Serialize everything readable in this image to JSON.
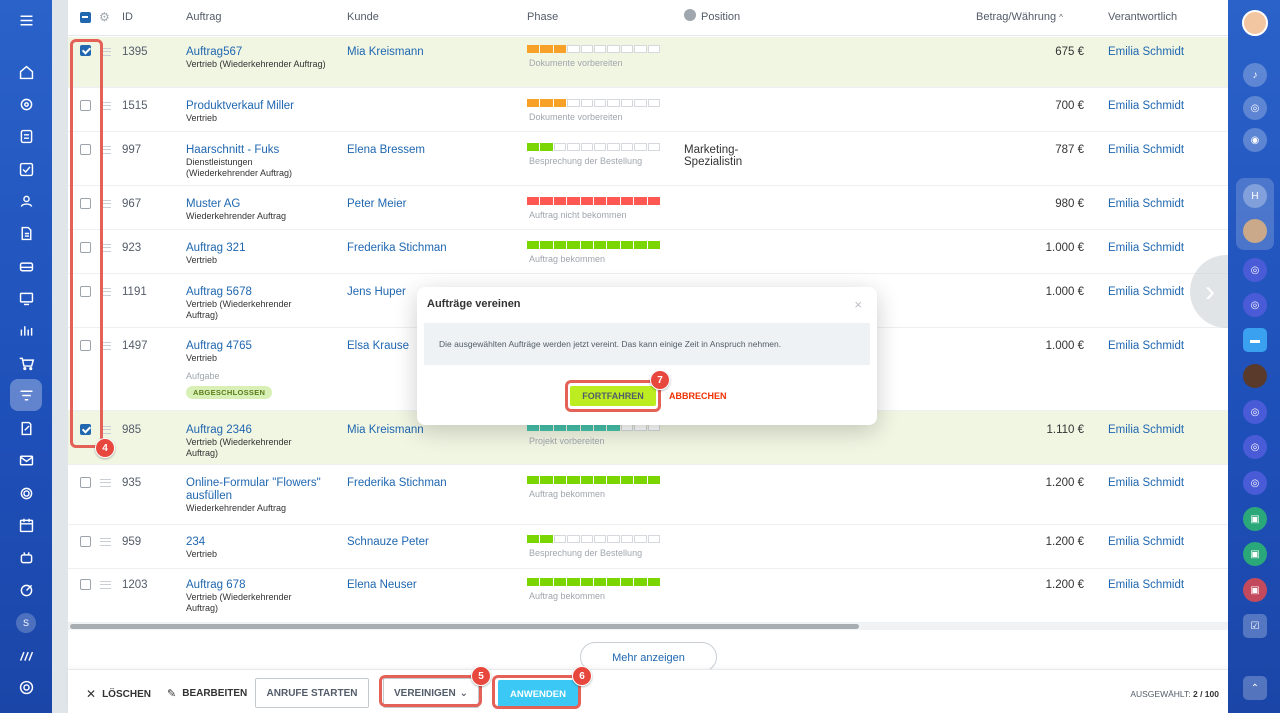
{
  "header": {
    "id": "ID",
    "auftrag": "Auftrag",
    "kunde": "Kunde",
    "phase": "Phase",
    "position": "Position",
    "betrag": "Betrag/Währung",
    "verantwortlich": "Verantwortlich"
  },
  "rows": [
    {
      "id": "1395",
      "title": "Auftrag567",
      "sub": "Vertrieb (Wiederkehrender Auftrag)",
      "customer": "Mia Kreismann",
      "phase": "Dokumente vorbereiten",
      "position": "",
      "amount": "675 €",
      "responsible": "Emilia Schmidt",
      "checked": true
    },
    {
      "id": "1515",
      "title": "Produktverkauf Miller",
      "sub": "Vertrieb",
      "customer": "",
      "phase": "Dokumente vorbereiten",
      "position": "",
      "amount": "700 €",
      "responsible": "Emilia Schmidt",
      "checked": false
    },
    {
      "id": "997",
      "title": "Haarschnitt - Fuks",
      "sub": "Dienstleistungen (Wiederkehrender Auftrag)",
      "customer": "Elena Bressem",
      "phase": "Besprechung der Bestellung",
      "position": "Marketing-Spezialistin",
      "amount": "787 €",
      "responsible": "Emilia Schmidt",
      "checked": false
    },
    {
      "id": "967",
      "title": "Muster AG",
      "sub": "Wiederkehrender Auftrag",
      "customer": "Peter Meier",
      "phase": "Auftrag nicht bekommen",
      "position": "",
      "amount": "980 €",
      "responsible": "Emilia Schmidt",
      "checked": false
    },
    {
      "id": "923",
      "title": "Auftrag 321",
      "sub": "Vertrieb",
      "customer": "Frederika Stichman",
      "phase": "Auftrag bekommen",
      "position": "",
      "amount": "1.000 €",
      "responsible": "Emilia Schmidt",
      "checked": false
    },
    {
      "id": "1191",
      "title": "Auftrag 5678",
      "sub": "Vertrieb (Wiederkehrender Auftrag)",
      "customer": "Jens Huper",
      "phase": "",
      "position": "",
      "amount": "1.000 €",
      "responsible": "Emilia Schmidt",
      "checked": false
    },
    {
      "id": "1497",
      "title": "Auftrag 4765",
      "sub": "Vertrieb",
      "customer": "Elsa Krause",
      "phase": "",
      "position": "",
      "amount": "1.000 €",
      "responsible": "Emilia Schmidt",
      "checked": false,
      "task_label": "Aufgabe",
      "badge": "ABGESCHLOSSEN"
    },
    {
      "id": "985",
      "title": "Auftrag 2346",
      "sub": "Vertrieb (Wiederkehrender Auftrag)",
      "customer": "Mia Kreismann",
      "phase": "Projekt vorbereiten",
      "position": "",
      "amount": "1.110 €",
      "responsible": "Emilia Schmidt",
      "checked": true
    },
    {
      "id": "935",
      "title": "Online-Formular \"Flowers\" ausfüllen",
      "sub": "Wiederkehrender Auftrag",
      "customer": "Frederika Stichman",
      "phase": "Auftrag bekommen",
      "position": "",
      "amount": "1.200 €",
      "responsible": "Emilia Schmidt",
      "checked": false
    },
    {
      "id": "959",
      "title": "234",
      "sub": "Vertrieb",
      "customer": "Schnauze Peter",
      "phase": "Besprechung der Bestellung",
      "position": "",
      "amount": "1.200 €",
      "responsible": "Emilia Schmidt",
      "checked": false
    },
    {
      "id": "1203",
      "title": "Auftrag 678",
      "sub": "Vertrieb (Wiederkehrender Auftrag)",
      "customer": "Elena Neuser",
      "phase": "Auftrag bekommen",
      "position": "",
      "amount": "1.200 €",
      "responsible": "Emilia Schmidt",
      "checked": false
    }
  ],
  "more_button": "Mehr anzeigen",
  "action_bar": {
    "delete": "LÖSCHEN",
    "edit": "BEARBEITEN",
    "calls": "ANRUFE STARTEN",
    "merge": "VEREINIGEN",
    "apply": "ANWENDEN",
    "selected_label": "AUSGEWÄHLT:",
    "selected_count": "2 / 100"
  },
  "modal": {
    "title": "Aufträge vereinen",
    "body": "Die ausgewählten Aufträge werden jetzt vereint. Das kann einige Zeit in Anspruch nehmen.",
    "confirm": "FORTFAHREN",
    "cancel": "ABBRECHEN"
  },
  "annotations": [
    "4",
    "5",
    "6",
    "7"
  ],
  "colors": {
    "accent": "#2067b0",
    "sidebar": "#2060c5",
    "apply": "#3bc8f5",
    "confirm": "#bbed21",
    "cancel": "#ef3000",
    "highlight": "#e46158",
    "phase_orange": "#f7a128",
    "phase_green": "#7bd500",
    "phase_red": "#ff5752",
    "phase_teal": "#47c4ad"
  }
}
